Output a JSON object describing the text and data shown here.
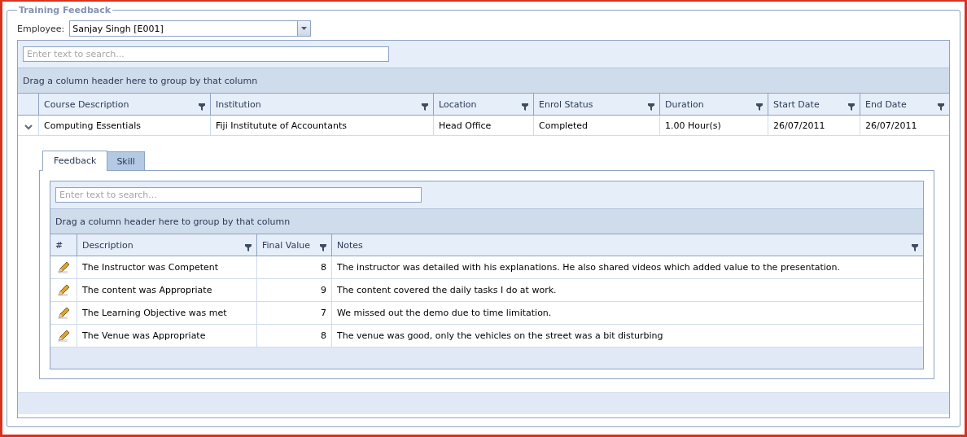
{
  "panel": {
    "title": "Training Feedback"
  },
  "employee": {
    "label": "Employee:",
    "value": "Sanjay Singh [E001]"
  },
  "courses_grid": {
    "search": {
      "placeholder": "Enter text to search..."
    },
    "group_hint": "Drag a column header here to group by that column",
    "columns": [
      {
        "label": "Course Description",
        "filter": true
      },
      {
        "label": "Institution",
        "filter": true
      },
      {
        "label": "Location",
        "filter": true
      },
      {
        "label": "Enrol Status",
        "filter": true
      },
      {
        "label": "Duration",
        "filter": true
      },
      {
        "label": "Start Date",
        "filter": true
      },
      {
        "label": "End Date",
        "filter": true
      }
    ],
    "rows": [
      {
        "expanded": true,
        "cells": [
          "Computing Essentials",
          "Fiji Institutute of Accountants",
          "Head Office",
          "Completed",
          "1.00 Hour(s)",
          "26/07/2011",
          "26/07/2011"
        ]
      }
    ]
  },
  "detail": {
    "tabs": [
      {
        "label": "Feedback",
        "selected": true
      },
      {
        "label": "Skill",
        "selected": false
      }
    ],
    "grid": {
      "search": {
        "placeholder": "Enter text to search..."
      },
      "group_hint": "Drag a column header here to group by that column",
      "columns": [
        {
          "label": "#",
          "filter": false
        },
        {
          "label": "Description",
          "filter": true
        },
        {
          "label": "Final Value",
          "filter": true
        },
        {
          "label": "Notes",
          "filter": true
        }
      ],
      "rows": [
        {
          "cells": [
            "",
            "The Instructor was Competent",
            "8",
            "The instructor was detailed with his explanations. He also shared videos which added value to the presentation."
          ]
        },
        {
          "cells": [
            "",
            "The content was Appropriate",
            "9",
            "The content covered the daily tasks I do at work."
          ]
        },
        {
          "cells": [
            "",
            "The Learning Objective was met",
            "7",
            "We missed out the demo due to time limitation."
          ]
        },
        {
          "cells": [
            "",
            "The Venue was Appropriate",
            "8",
            "The venue was good, only the vehicles on the street was a bit disturbing"
          ]
        }
      ]
    }
  }
}
